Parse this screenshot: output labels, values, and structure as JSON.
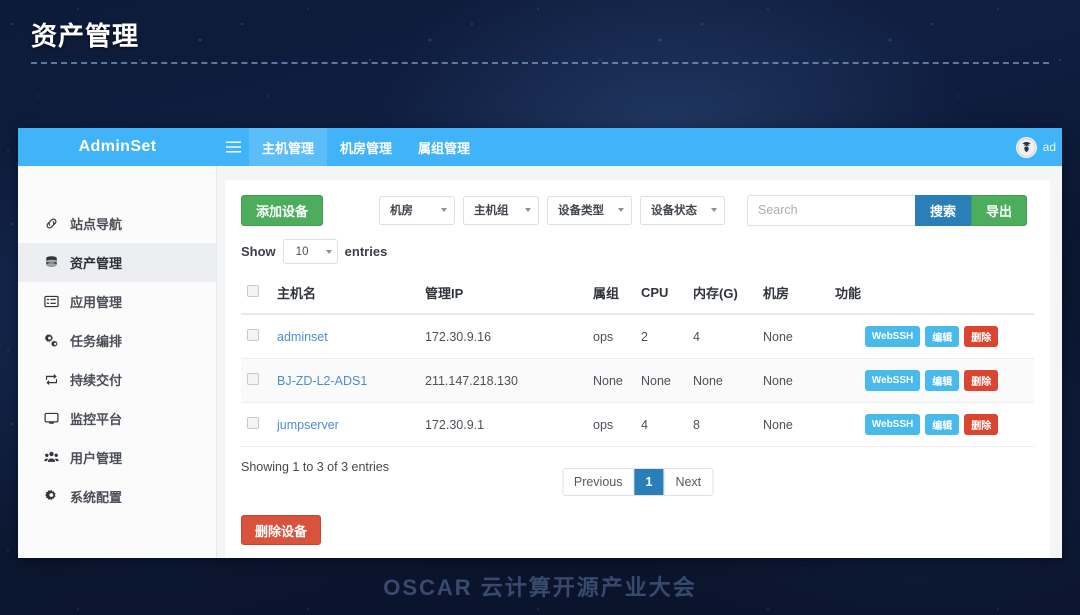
{
  "slide": {
    "title": "资产管理",
    "footer_text": "OSCAR 云计算开源产业大会"
  },
  "navbar": {
    "brand": "AdminSet",
    "menu_icon": "hamburger-icon",
    "tabs": [
      {
        "label": "主机管理",
        "active": true
      },
      {
        "label": "机房管理",
        "active": false
      },
      {
        "label": "属组管理",
        "active": false
      }
    ],
    "user": {
      "name": "ad",
      "avatar_icon": "eagle-emblem-avatar"
    },
    "bg_color": "#41b3f9",
    "active_tab_color": "#5bbefa"
  },
  "sidebar": {
    "items": [
      {
        "label": "站点导航",
        "icon": "link-icon",
        "active": false
      },
      {
        "label": "资产管理",
        "icon": "database-icon",
        "active": true
      },
      {
        "label": "应用管理",
        "icon": "list-alt-icon",
        "active": false
      },
      {
        "label": "任务编排",
        "icon": "gears-icon",
        "active": false
      },
      {
        "label": "持续交付",
        "icon": "sync-icon",
        "active": false
      },
      {
        "label": "监控平台",
        "icon": "desktop-icon",
        "active": false
      },
      {
        "label": "用户管理",
        "icon": "users-icon",
        "active": false
      },
      {
        "label": "系统配置",
        "icon": "cog-icon",
        "active": false
      }
    ]
  },
  "toolbar": {
    "add_label": "添加设备",
    "add_color": "#4cae5c",
    "filters": [
      {
        "label": "机房"
      },
      {
        "label": "主机组"
      },
      {
        "label": "设备类型"
      },
      {
        "label": "设备状态"
      }
    ],
    "search": {
      "value": "",
      "placeholder": "Search"
    },
    "search_label": "搜索",
    "search_color": "#2a7fb8",
    "export_label": "导出",
    "export_color": "#4cae5c"
  },
  "show_entries": {
    "prefix": "Show",
    "value": "10",
    "suffix": "entries"
  },
  "table": {
    "columns": [
      {
        "label": "",
        "key": "checkbox"
      },
      {
        "label": "主机名",
        "key": "hostname"
      },
      {
        "label": "管理IP",
        "key": "ip"
      },
      {
        "label": "属组",
        "key": "group"
      },
      {
        "label": "CPU",
        "key": "cpu"
      },
      {
        "label": "内存(G)",
        "key": "memory"
      },
      {
        "label": "机房",
        "key": "room"
      },
      {
        "label": "功能",
        "key": "actions"
      }
    ],
    "rows": [
      {
        "hostname": "adminset",
        "ip": "172.30.9.16",
        "group": "ops",
        "cpu": "2",
        "memory": "4",
        "room": "None"
      },
      {
        "hostname": "BJ-ZD-L2-ADS1",
        "ip": "211.147.218.130",
        "group": "None",
        "cpu": "None",
        "memory": "None",
        "room": "None"
      },
      {
        "hostname": "jumpserver",
        "ip": "172.30.9.1",
        "group": "ops",
        "cpu": "4",
        "memory": "8",
        "room": "None"
      }
    ],
    "row_actions": {
      "webssh_label": "WebSSH",
      "edit_label": "编辑",
      "delete_label": "删除",
      "webssh_color": "#48bbec",
      "edit_color": "#48bbec",
      "delete_color": "#d9452f"
    }
  },
  "table_footer": {
    "showing_text": "Showing 1 to 3 of 3 entries",
    "pagination": {
      "previous_label": "Previous",
      "page_label": "1",
      "next_label": "Next",
      "active_color": "#2a7fb8"
    }
  },
  "bottom_action": {
    "delete_devices_label": "删除设备",
    "color": "#d9533c"
  }
}
